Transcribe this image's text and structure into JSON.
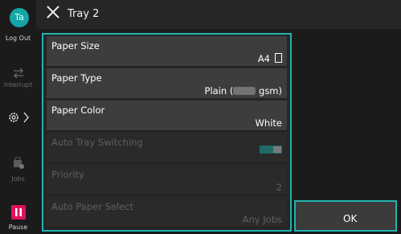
{
  "header": {
    "title": "Tray 2"
  },
  "rail": {
    "avatar_initials": "Ta",
    "logout_label": "Log Out",
    "interrupt_label": "Interrupt",
    "jobs_label": "Jobs",
    "pause_label": "Pause"
  },
  "settings": [
    {
      "label": "Paper Size",
      "value": "A4"
    },
    {
      "label": "Paper Type",
      "value_prefix": "Plain (",
      "value_suffix": "gsm)"
    },
    {
      "label": "Paper Color",
      "value": "White"
    },
    {
      "label": "Auto Tray Switching",
      "value": ""
    },
    {
      "label": "Priority",
      "value": "2"
    },
    {
      "label": "Auto Paper Select",
      "value": "Any Jobs"
    }
  ],
  "ok_label": "OK",
  "colors": {
    "accent": "#1fb3ae",
    "pause": "#e0115f"
  }
}
